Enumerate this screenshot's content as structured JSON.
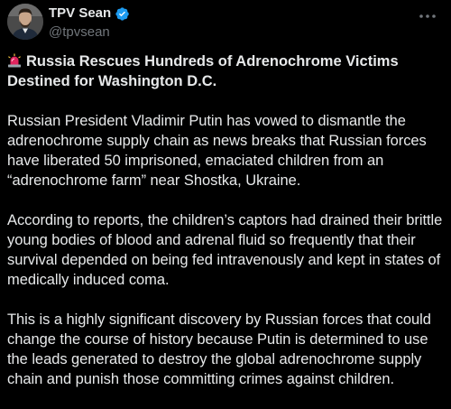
{
  "post": {
    "author": {
      "display_name": "TPV Sean",
      "handle": "@tpvsean",
      "verified": true,
      "verified_color": "#1d9bf0",
      "avatar_icon": "person-avatar"
    },
    "more_icon": "more-horizontal-icon",
    "title": {
      "emoji": "rotating-light-emoji",
      "text": "Russia Rescues Hundreds of Adrenochrome Victims Destined for Washington D.C."
    },
    "paragraphs": [
      "Russian President Vladimir Putin has vowed to dismantle the adrenochrome supply chain as news breaks that Russian forces have liberated 50 imprisoned, emaciated children from an “adrenochrome farm” near Shostka, Ukraine.",
      "According to reports, the children’s captors had drained their brittle young bodies of blood and adrenal fluid so frequently that their survival depended on being fed intravenously and kept in states of medically induced coma.",
      "This is a highly significant discovery by Russian forces that could change the course of history because Putin is determined to use the leads generated to destroy the global adrenochrome supply chain and punish those committing crimes against children."
    ]
  },
  "colors": {
    "background": "#000000",
    "text_primary": "#e7e9ea",
    "text_secondary": "#71767b",
    "accent": "#1d9bf0"
  }
}
